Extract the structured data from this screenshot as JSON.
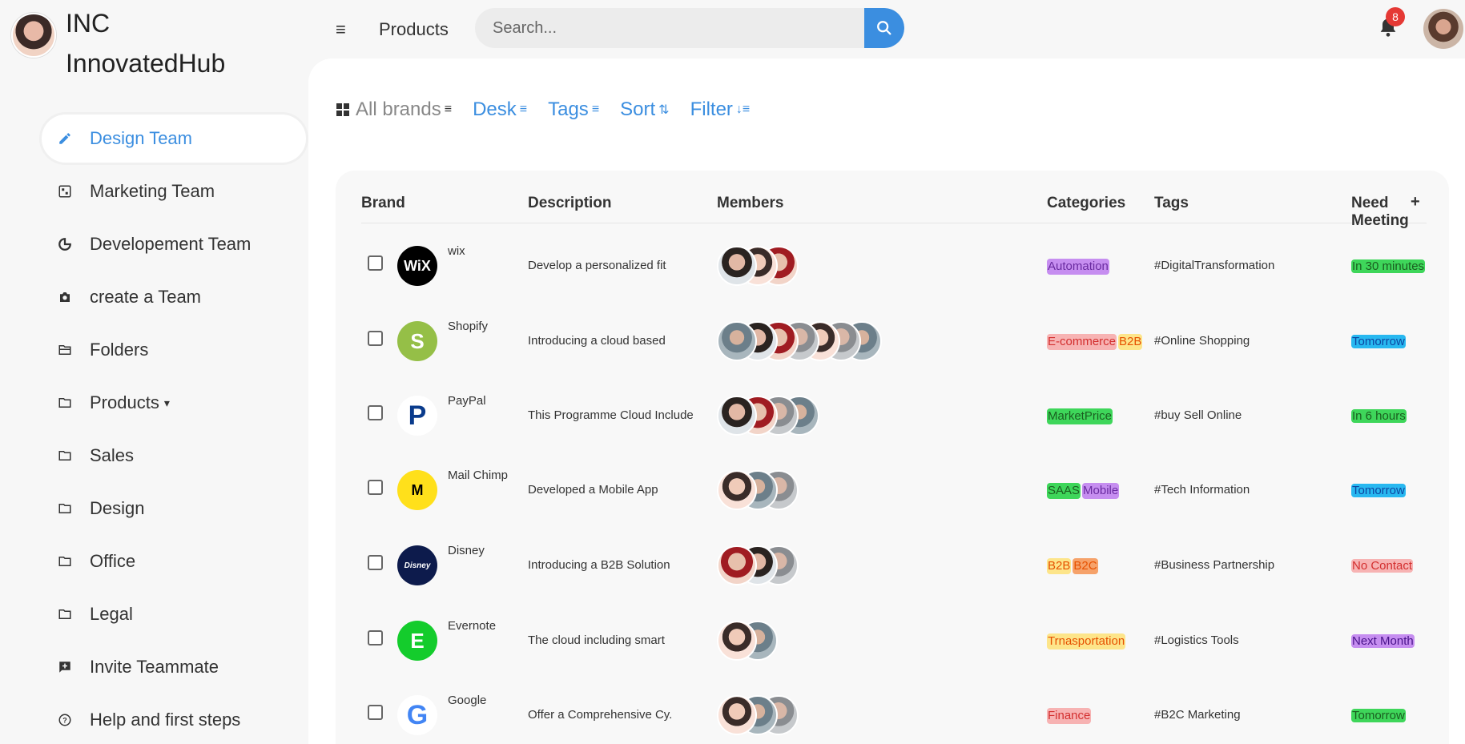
{
  "brand": {
    "name_line1": "INC",
    "name_line2": "InnovatedHub"
  },
  "topbar": {
    "page_title": "Products",
    "search_placeholder": "Search...",
    "notification_count": "8"
  },
  "sidebar": {
    "items": [
      {
        "label": "Design Team",
        "icon": "pencil-icon",
        "active": true
      },
      {
        "label": "Marketing Team",
        "icon": "store-icon"
      },
      {
        "label": "Developement Team",
        "icon": "chart-pie-icon"
      },
      {
        "label": "create a Team",
        "icon": "camera-icon"
      },
      {
        "label": "Folders",
        "icon": "folder-open-icon"
      },
      {
        "label": "Products",
        "icon": "folder-icon",
        "caret": true
      },
      {
        "label": "Sales",
        "icon": "folder-icon"
      },
      {
        "label": "Design",
        "icon": "folder-icon"
      },
      {
        "label": "Office",
        "icon": "folder-icon"
      },
      {
        "label": "Legal",
        "icon": "folder-icon"
      },
      {
        "label": "Invite Teammate",
        "icon": "message-plus-icon"
      },
      {
        "label": "Help and first steps",
        "icon": "help-circle-icon"
      }
    ]
  },
  "filters": {
    "all_brands": "All brands",
    "desk": "Desk",
    "tags": "Tags",
    "sort": "Sort",
    "filter": "Filter"
  },
  "table": {
    "headers": {
      "brand": "Brand",
      "description": "Description",
      "members": "Members",
      "categories": "Categories",
      "tags": "Tags",
      "need_meeting": "Need Meeting",
      "add": "+"
    },
    "rows": [
      {
        "brand": "wix",
        "logo_text": "WiX",
        "logo_color": "#000000",
        "description": "Develop a personalized fit",
        "members": [
          "a",
          "e",
          "b"
        ],
        "categories": [
          {
            "label": "Automation",
            "style": "purple"
          }
        ],
        "tags": "#DigitalTransformation",
        "meeting": {
          "label": "In 30 minutes",
          "style": "green"
        }
      },
      {
        "brand": "Shopify",
        "logo_text": "S",
        "logo_color": "#95bf47",
        "description": "Introducing a cloud based",
        "members": [
          "d",
          "a",
          "b",
          "c",
          "e",
          "c",
          "d"
        ],
        "categories": [
          {
            "label": "E-commerce",
            "style": "pink"
          },
          {
            "label": "B2B",
            "style": "yellow"
          }
        ],
        "tags": "#Online Shopping",
        "meeting": {
          "label": "Tomorrow",
          "style": "blue"
        }
      },
      {
        "brand": "PayPal",
        "logo_text": "P",
        "logo_color": "#ffffff",
        "description": "This Programme Cloud Include",
        "members": [
          "a",
          "b",
          "c",
          "d"
        ],
        "categories": [
          {
            "label": "MarketPrice",
            "style": "green"
          }
        ],
        "tags": "#buy Sell Online",
        "meeting": {
          "label": "In 6 hours",
          "style": "green"
        }
      },
      {
        "brand": "Mail Chimp",
        "logo_text": "M",
        "logo_color": "#ffe01b",
        "description": "Developed a Mobile App",
        "members": [
          "e",
          "d",
          "c"
        ],
        "categories": [
          {
            "label": "SAAS",
            "style": "green"
          },
          {
            "label": "Mobile",
            "style": "purple"
          }
        ],
        "tags": "#Tech Information",
        "meeting": {
          "label": "Tomorrow",
          "style": "blue"
        }
      },
      {
        "brand": "Disney",
        "logo_text": "Disney",
        "logo_color": "#0d1b4c",
        "description": "Introducing a B2B Solution",
        "members": [
          "b",
          "a",
          "c"
        ],
        "categories": [
          {
            "label": "B2B",
            "style": "yellow"
          },
          {
            "label": "B2C",
            "style": "orange"
          }
        ],
        "tags": "#Business Partnership",
        "meeting": {
          "label": "No Contact",
          "style": "pink"
        }
      },
      {
        "brand": "Evernote",
        "logo_text": "E",
        "logo_color": "#14cc2c",
        "description": "The cloud including smart",
        "members": [
          "e",
          "d"
        ],
        "categories": [
          {
            "label": "Trnasportation",
            "style": "yellow"
          }
        ],
        "tags": "#Logistics Tools",
        "meeting": {
          "label": "Next Month",
          "style": "mpurple"
        }
      },
      {
        "brand": "Google",
        "logo_text": "G",
        "logo_color": "#ffffff",
        "description": "Offer a Comprehensive Cy.",
        "members": [
          "e",
          "d",
          "c"
        ],
        "categories": [
          {
            "label": "Finance",
            "style": "pink"
          }
        ],
        "tags": "#B2C Marketing",
        "meeting": {
          "label": "Tomorrow",
          "style": "green"
        }
      }
    ]
  }
}
